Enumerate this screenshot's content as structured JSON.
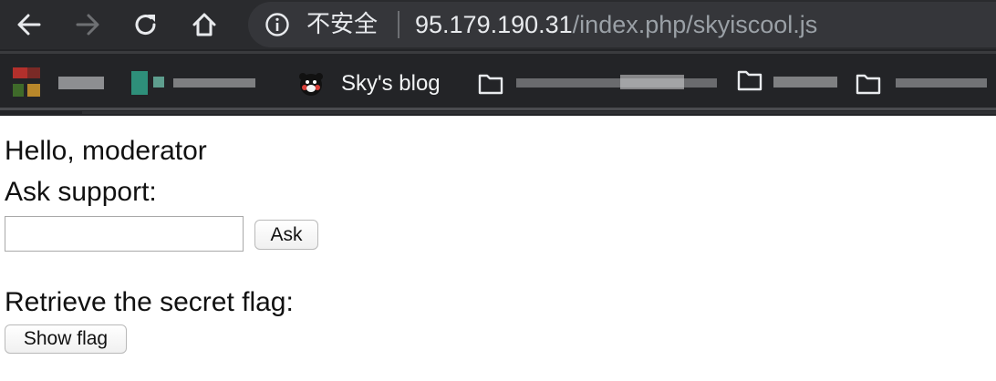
{
  "browser": {
    "security_label": "不安全",
    "url_host": "95.179.190.31",
    "url_path": "/index.php/skyiscool.js",
    "bookmark_label": "Sky's blog",
    "bookmark_icon": "kumamon-bear-icon"
  },
  "page": {
    "greeting": "Hello, moderator",
    "ask_title": "Ask support:",
    "ask_input_value": "",
    "ask_button_label": "Ask",
    "retrieve_title": "Retrieve the secret flag:",
    "flag_button_label": "Show flag"
  },
  "colors": {
    "chrome_bg": "#2a2b2e",
    "omnibox_bg": "#35363a",
    "url_host": "#e8eaed",
    "url_path": "#9aa0a6"
  }
}
